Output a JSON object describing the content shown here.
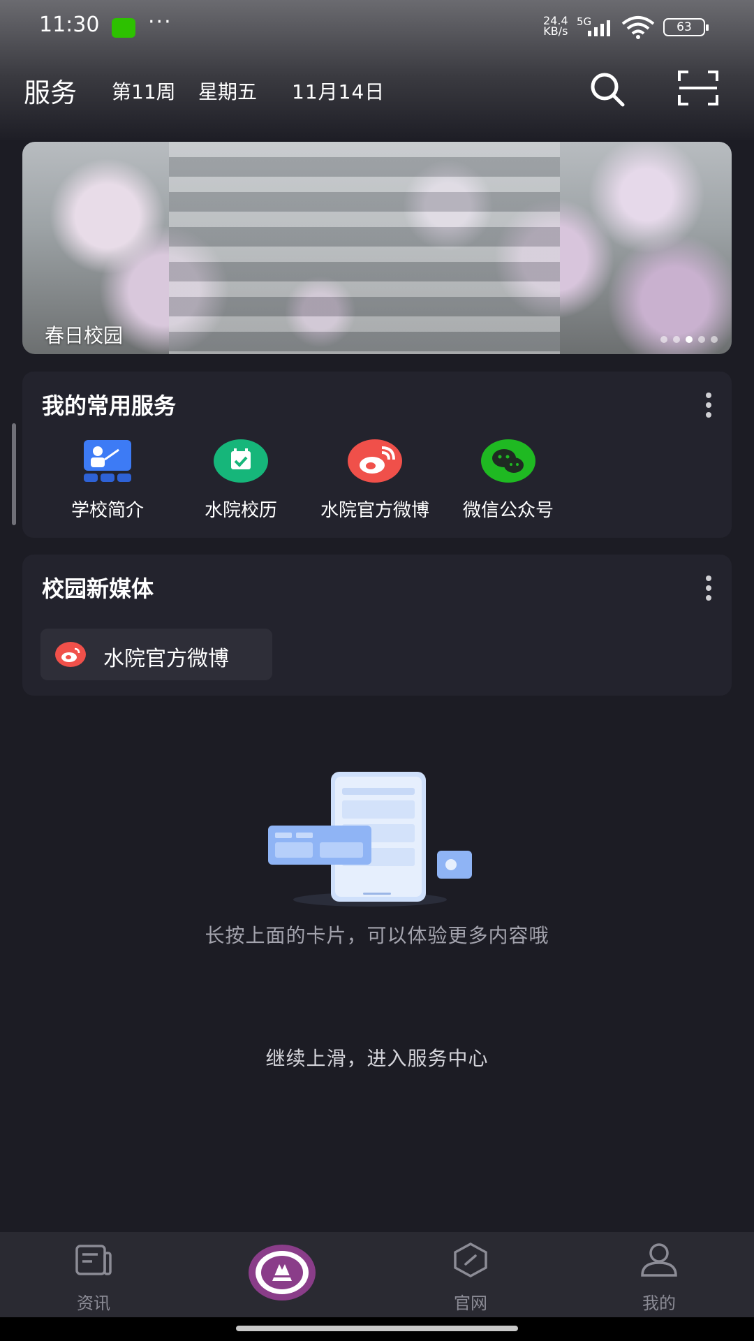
{
  "status_bar": {
    "time": "11:30",
    "more": "···",
    "net_speed": "24.4",
    "net_unit": "KB/s",
    "net_type": "5G",
    "battery": "63"
  },
  "header": {
    "title": "服务",
    "week": "第11周",
    "weekday": "星期五",
    "date": "11月14日"
  },
  "banner": {
    "caption": "春日校园",
    "slide_count": 5,
    "active_slide": 3
  },
  "common_services": {
    "title": "我的常用服务",
    "items": [
      {
        "label": "学校简介",
        "icon": "school-intro-icon",
        "color": "#3d7bf5"
      },
      {
        "label": "水院校历",
        "icon": "calendar-icon",
        "color": "#16b67a"
      },
      {
        "label": "水院官方微博",
        "icon": "weibo-icon",
        "color": "#f0504a"
      },
      {
        "label": "微信公众号",
        "icon": "wechat-icon",
        "color": "#1fb922"
      }
    ]
  },
  "new_media": {
    "title": "校园新媒体",
    "items": [
      {
        "label": "水院官方微博",
        "icon": "weibo-icon",
        "color": "#f0504a"
      }
    ]
  },
  "hint": {
    "long_press": "长按上面的卡片，可以体验更多内容哦",
    "swipe_up": "继续上滑，进入服务中心"
  },
  "bottom_nav": {
    "items": [
      {
        "label": "资讯",
        "icon": "news-icon"
      },
      {
        "label": "",
        "icon": "university-logo-icon"
      },
      {
        "label": "官网",
        "icon": "compass-icon"
      },
      {
        "label": "我的",
        "icon": "person-icon"
      }
    ]
  },
  "colors": {
    "background": "#1c1c24",
    "card": "#23232d",
    "nav": "#2a2a32"
  }
}
